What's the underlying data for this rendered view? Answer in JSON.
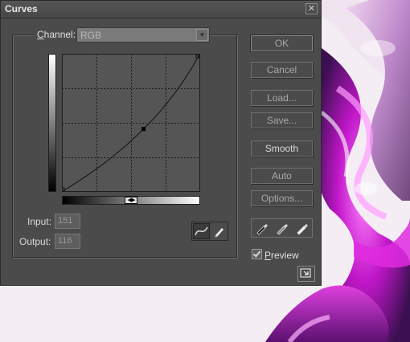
{
  "window": {
    "title": "Curves",
    "close_glyph": "✕"
  },
  "channel": {
    "label_prefix": "",
    "label_underlined": "C",
    "label_rest": "hannel:",
    "value": "RGB"
  },
  "graph": {
    "grid_divisions": 4,
    "curve_point": {
      "input": 151,
      "output": 116
    }
  },
  "fields": {
    "input_label": "Input:",
    "input_value": "151",
    "output_label": "Output:",
    "output_value": "116"
  },
  "tools": {
    "curve_icon": "curve-tool-icon",
    "pencil_icon": "pencil-tool-icon"
  },
  "buttons": {
    "ok": "OK",
    "cancel": "Cancel",
    "load": "Load...",
    "save": "Save...",
    "smooth": "Smooth",
    "auto": "Auto",
    "options": "Options..."
  },
  "eyedroppers": [
    "black-eyedropper-icon",
    "gray-eyedropper-icon",
    "white-eyedropper-icon"
  ],
  "preview": {
    "label_underlined": "P",
    "label_rest": "review",
    "checked": true
  },
  "colors": {
    "dialog_bg": "#4b4b4b",
    "accent_magenta": "#c020c0"
  }
}
